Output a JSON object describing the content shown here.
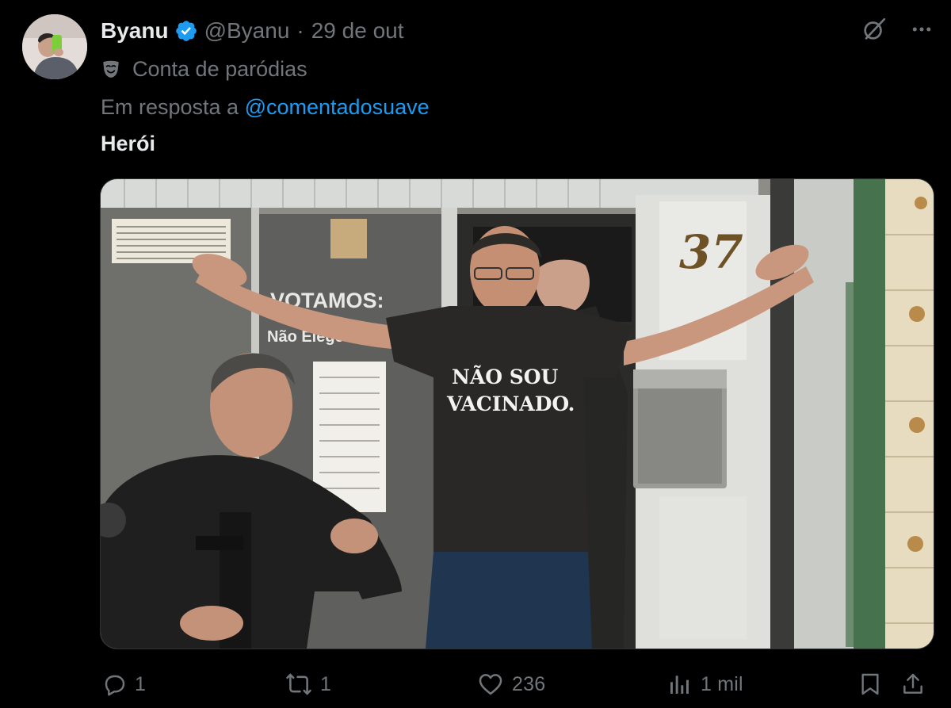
{
  "tweet": {
    "author": {
      "display_name": "Byanu",
      "handle": "@Byanu",
      "verified": true,
      "avatar": "avatar-photo"
    },
    "separator": "·",
    "timestamp": "29 de out",
    "parody_label": "Conta de paródias",
    "reply_prefix": "Em resposta a",
    "reply_to": "@comentadosuave",
    "text": "Herói",
    "media": {
      "type": "photo",
      "shirt_line1": "NÃO SOU",
      "shirt_line2": "VACINADO.",
      "door_number": "37",
      "sign_line1": "VOTAMOS:",
      "sign_line2": "Não Elegemos"
    },
    "stats": {
      "replies": "1",
      "reposts": "1",
      "likes": "236",
      "views": "1 mil"
    }
  },
  "colors": {
    "background": "#000000",
    "text_primary": "#e7e9ea",
    "text_secondary": "#71767b",
    "accent": "#1d9bf0"
  },
  "icons": {
    "verified": "verified-badge-icon",
    "grok": "grok-icon",
    "more": "more-icon",
    "parody": "parody-mask-icon",
    "reply": "reply-icon",
    "repost": "repost-icon",
    "like": "like-icon",
    "views": "views-icon",
    "bookmark": "bookmark-icon",
    "share": "share-icon"
  }
}
